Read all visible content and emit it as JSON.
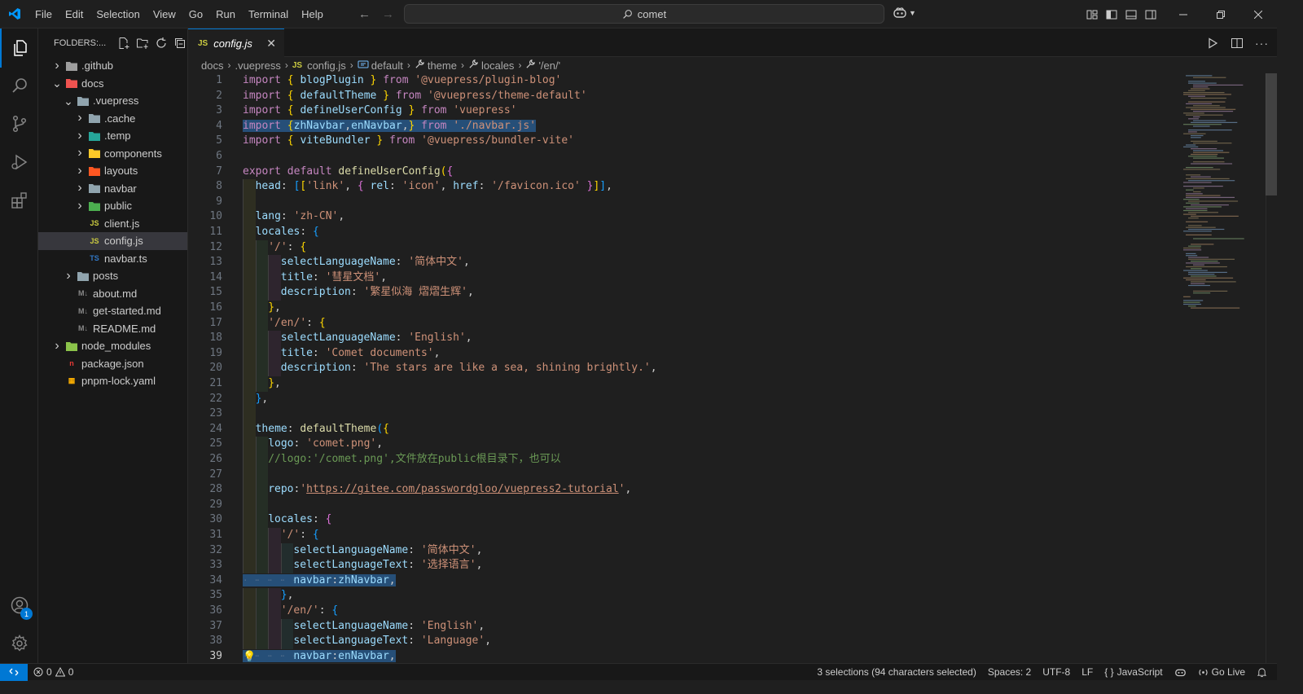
{
  "window": {
    "menu": [
      "File",
      "Edit",
      "Selection",
      "View",
      "Go",
      "Run",
      "Terminal",
      "Help"
    ],
    "search_text": "comet"
  },
  "sidebar": {
    "header_label": "FOLDERS:...",
    "tree": [
      {
        "label": ".github",
        "type": "folder",
        "expanded": false,
        "depth": 0,
        "icon": "github-folder-icon",
        "color": "#9e9e9e"
      },
      {
        "label": "docs",
        "type": "folder",
        "expanded": true,
        "depth": 0,
        "icon": "docs-folder-icon",
        "color": "#ef5350"
      },
      {
        "label": ".vuepress",
        "type": "folder",
        "expanded": true,
        "depth": 1,
        "icon": "folder-icon",
        "color": "#90a4ae"
      },
      {
        "label": ".cache",
        "type": "folder",
        "expanded": false,
        "depth": 2,
        "icon": "folder-icon",
        "color": "#90a4ae"
      },
      {
        "label": ".temp",
        "type": "folder",
        "expanded": false,
        "depth": 2,
        "icon": "temp-folder-icon",
        "color": "#26a69a"
      },
      {
        "label": "components",
        "type": "folder",
        "expanded": false,
        "depth": 2,
        "icon": "components-folder-icon",
        "color": "#ffca28"
      },
      {
        "label": "layouts",
        "type": "folder",
        "expanded": false,
        "depth": 2,
        "icon": "layouts-folder-icon",
        "color": "#ff5722"
      },
      {
        "label": "navbar",
        "type": "folder",
        "expanded": false,
        "depth": 2,
        "icon": "folder-icon",
        "color": "#90a4ae"
      },
      {
        "label": "public",
        "type": "folder",
        "expanded": false,
        "depth": 2,
        "icon": "public-folder-icon",
        "color": "#4caf50"
      },
      {
        "label": "client.js",
        "type": "file",
        "depth": 2,
        "icon": "js-file-icon",
        "color": "#cbcb41",
        "badge": "JS"
      },
      {
        "label": "config.js",
        "type": "file",
        "depth": 2,
        "icon": "js-file-icon",
        "color": "#cbcb41",
        "badge": "JS",
        "selected": true
      },
      {
        "label": "navbar.ts",
        "type": "file",
        "depth": 2,
        "icon": "ts-file-icon",
        "color": "#3178c6",
        "badge": "TS"
      },
      {
        "label": "posts",
        "type": "folder",
        "expanded": false,
        "depth": 1,
        "icon": "folder-icon",
        "color": "#90a4ae"
      },
      {
        "label": "about.md",
        "type": "file",
        "depth": 1,
        "icon": "md-file-icon",
        "color": "#888888",
        "badge": "M↓"
      },
      {
        "label": "get-started.md",
        "type": "file",
        "depth": 1,
        "icon": "md-file-icon",
        "color": "#888888",
        "badge": "M↓"
      },
      {
        "label": "README.md",
        "type": "file",
        "depth": 1,
        "icon": "md-file-icon",
        "color": "#888888",
        "badge": "M↓"
      },
      {
        "label": "node_modules",
        "type": "folder",
        "expanded": false,
        "depth": 0,
        "icon": "node-modules-folder-icon",
        "color": "#8bc34a"
      },
      {
        "label": "package.json",
        "type": "file",
        "depth": 0,
        "icon": "npm-file-icon",
        "color": "#e53935",
        "badge": "n"
      },
      {
        "label": "pnpm-lock.yaml",
        "type": "file",
        "depth": 0,
        "icon": "pnpm-file-icon",
        "color": "#f9ad00",
        "badge": "▦"
      }
    ]
  },
  "tabs": [
    {
      "label": "config.js",
      "badge": "JS",
      "active": true
    }
  ],
  "breadcrumbs": [
    {
      "label": "docs",
      "icon": ""
    },
    {
      "label": ".vuepress",
      "icon": ""
    },
    {
      "label": "config.js",
      "icon": "JS"
    },
    {
      "label": "default",
      "icon": "symbol-variable-icon"
    },
    {
      "label": "theme",
      "icon": "wrench-icon"
    },
    {
      "label": "locales",
      "icon": "wrench-icon"
    },
    {
      "label": "'/en/'",
      "icon": "wrench-icon"
    }
  ],
  "editor": {
    "lines": [
      {
        "n": 1,
        "indent": 0,
        "toks": [
          [
            "kw",
            "import "
          ],
          [
            "br1",
            "{ "
          ],
          [
            "var",
            "blogPlugin"
          ],
          [
            "br1",
            " }"
          ],
          [
            "kw",
            " from "
          ],
          [
            "str",
            "'@vuepress/plugin-blog'"
          ]
        ]
      },
      {
        "n": 2,
        "indent": 0,
        "toks": [
          [
            "kw",
            "import "
          ],
          [
            "br1",
            "{ "
          ],
          [
            "var",
            "defaultTheme"
          ],
          [
            "br1",
            " }"
          ],
          [
            "kw",
            " from "
          ],
          [
            "str",
            "'@vuepress/theme-default'"
          ]
        ]
      },
      {
        "n": 3,
        "indent": 0,
        "toks": [
          [
            "kw",
            "import "
          ],
          [
            "br1",
            "{ "
          ],
          [
            "var",
            "defineUserConfig"
          ],
          [
            "br1",
            " }"
          ],
          [
            "kw",
            " from "
          ],
          [
            "str",
            "'vuepress'"
          ]
        ]
      },
      {
        "n": 4,
        "indent": 0,
        "selected": true,
        "toks": [
          [
            "kw",
            "import "
          ],
          [
            "br1",
            "{"
          ],
          [
            "var",
            "zhNavbar"
          ],
          [
            "punc",
            ","
          ],
          [
            "var",
            "enNavbar"
          ],
          [
            "punc",
            ","
          ],
          [
            "br1",
            "}"
          ],
          [
            "kw",
            " from "
          ],
          [
            "str",
            "'./navbar.js'"
          ]
        ]
      },
      {
        "n": 5,
        "indent": 0,
        "toks": [
          [
            "kw",
            "import "
          ],
          [
            "br1",
            "{ "
          ],
          [
            "var",
            "viteBundler"
          ],
          [
            "br1",
            " }"
          ],
          [
            "kw",
            " from "
          ],
          [
            "str",
            "'@vuepress/bundler-vite'"
          ]
        ]
      },
      {
        "n": 6,
        "indent": 0,
        "toks": []
      },
      {
        "n": 7,
        "indent": 0,
        "toks": [
          [
            "kw",
            "export "
          ],
          [
            "kw",
            "default "
          ],
          [
            "fn",
            "defineUserConfig"
          ],
          [
            "br1",
            "("
          ],
          [
            "br2",
            "{"
          ]
        ]
      },
      {
        "n": 8,
        "indent": 1,
        "toks": [
          [
            "prop",
            "head"
          ],
          [
            "punc",
            ": "
          ],
          [
            "br3",
            "["
          ],
          [
            "br1",
            "["
          ],
          [
            "str",
            "'link'"
          ],
          [
            "punc",
            ", "
          ],
          [
            "br2",
            "{ "
          ],
          [
            "prop",
            "rel"
          ],
          [
            "punc",
            ": "
          ],
          [
            "str",
            "'icon'"
          ],
          [
            "punc",
            ", "
          ],
          [
            "prop",
            "href"
          ],
          [
            "punc",
            ": "
          ],
          [
            "str",
            "'/favicon.ico'"
          ],
          [
            "br2",
            " }"
          ],
          [
            "br1",
            "]"
          ],
          [
            "br3",
            "]"
          ],
          [
            "punc",
            ","
          ]
        ]
      },
      {
        "n": 9,
        "indent": 1,
        "toks": []
      },
      {
        "n": 10,
        "indent": 1,
        "toks": [
          [
            "prop",
            "lang"
          ],
          [
            "punc",
            ": "
          ],
          [
            "str",
            "'zh-CN'"
          ],
          [
            "punc",
            ","
          ]
        ]
      },
      {
        "n": 11,
        "indent": 1,
        "toks": [
          [
            "prop",
            "locales"
          ],
          [
            "punc",
            ": "
          ],
          [
            "br3",
            "{"
          ]
        ]
      },
      {
        "n": 12,
        "indent": 2,
        "toks": [
          [
            "str",
            "'/'"
          ],
          [
            "punc",
            ": "
          ],
          [
            "br1",
            "{"
          ]
        ]
      },
      {
        "n": 13,
        "indent": 3,
        "toks": [
          [
            "prop",
            "selectLanguageName"
          ],
          [
            "punc",
            ": "
          ],
          [
            "str",
            "'简体中文'"
          ],
          [
            "punc",
            ","
          ]
        ]
      },
      {
        "n": 14,
        "indent": 3,
        "toks": [
          [
            "prop",
            "title"
          ],
          [
            "punc",
            ": "
          ],
          [
            "str",
            "'彗星文档'"
          ],
          [
            "punc",
            ","
          ]
        ]
      },
      {
        "n": 15,
        "indent": 3,
        "toks": [
          [
            "prop",
            "description"
          ],
          [
            "punc",
            ": "
          ],
          [
            "str",
            "'繁星似海 熠熠生辉'"
          ],
          [
            "punc",
            ","
          ]
        ]
      },
      {
        "n": 16,
        "indent": 2,
        "toks": [
          [
            "br1",
            "}"
          ],
          [
            "punc",
            ","
          ]
        ]
      },
      {
        "n": 17,
        "indent": 2,
        "toks": [
          [
            "str",
            "'/en/'"
          ],
          [
            "punc",
            ": "
          ],
          [
            "br1",
            "{"
          ]
        ]
      },
      {
        "n": 18,
        "indent": 3,
        "toks": [
          [
            "prop",
            "selectLanguageName"
          ],
          [
            "punc",
            ": "
          ],
          [
            "str",
            "'English'"
          ],
          [
            "punc",
            ","
          ]
        ]
      },
      {
        "n": 19,
        "indent": 3,
        "toks": [
          [
            "prop",
            "title"
          ],
          [
            "punc",
            ": "
          ],
          [
            "str",
            "'Comet documents'"
          ],
          [
            "punc",
            ","
          ]
        ]
      },
      {
        "n": 20,
        "indent": 3,
        "toks": [
          [
            "prop",
            "description"
          ],
          [
            "punc",
            ": "
          ],
          [
            "str",
            "'The stars are like a sea, shining brightly.'"
          ],
          [
            "punc",
            ","
          ]
        ]
      },
      {
        "n": 21,
        "indent": 2,
        "toks": [
          [
            "br1",
            "}"
          ],
          [
            "punc",
            ","
          ]
        ]
      },
      {
        "n": 22,
        "indent": 1,
        "toks": [
          [
            "br3",
            "}"
          ],
          [
            "punc",
            ","
          ]
        ]
      },
      {
        "n": 23,
        "indent": 1,
        "toks": []
      },
      {
        "n": 24,
        "indent": 1,
        "toks": [
          [
            "prop",
            "theme"
          ],
          [
            "punc",
            ": "
          ],
          [
            "fn",
            "defaultTheme"
          ],
          [
            "br3",
            "("
          ],
          [
            "br1",
            "{"
          ]
        ]
      },
      {
        "n": 25,
        "indent": 2,
        "toks": [
          [
            "prop",
            "logo"
          ],
          [
            "punc",
            ": "
          ],
          [
            "str",
            "'comet.png'"
          ],
          [
            "punc",
            ","
          ]
        ]
      },
      {
        "n": 26,
        "indent": 2,
        "toks": [
          [
            "cm",
            "//logo:'/comet.png',文件放在public根目录下，也可以"
          ]
        ]
      },
      {
        "n": 27,
        "indent": 2,
        "toks": []
      },
      {
        "n": 28,
        "indent": 2,
        "toks": [
          [
            "prop",
            "repo"
          ],
          [
            "punc",
            ":"
          ],
          [
            "str",
            "'"
          ],
          [
            "url",
            "https://gitee.com/passwordgloo/vuepress2-tutorial"
          ],
          [
            "str",
            "'"
          ],
          [
            "punc",
            ","
          ]
        ]
      },
      {
        "n": 29,
        "indent": 2,
        "toks": []
      },
      {
        "n": 30,
        "indent": 2,
        "toks": [
          [
            "prop",
            "locales"
          ],
          [
            "punc",
            ": "
          ],
          [
            "br2",
            "{"
          ]
        ]
      },
      {
        "n": 31,
        "indent": 3,
        "toks": [
          [
            "str",
            "'/'"
          ],
          [
            "punc",
            ": "
          ],
          [
            "br3",
            "{"
          ]
        ]
      },
      {
        "n": 32,
        "indent": 4,
        "toks": [
          [
            "prop",
            "selectLanguageName"
          ],
          [
            "punc",
            ": "
          ],
          [
            "str",
            "'简体中文'"
          ],
          [
            "punc",
            ","
          ]
        ]
      },
      {
        "n": 33,
        "indent": 4,
        "toks": [
          [
            "prop",
            "selectLanguageText"
          ],
          [
            "punc",
            ": "
          ],
          [
            "str",
            "'选择语言'"
          ],
          [
            "punc",
            ","
          ]
        ]
      },
      {
        "n": 34,
        "indent": 4,
        "selected": true,
        "dots": true,
        "toks": [
          [
            "prop",
            "navbar"
          ],
          [
            "punc",
            ":"
          ],
          [
            "var",
            "zhNavbar"
          ],
          [
            "punc",
            ","
          ]
        ]
      },
      {
        "n": 35,
        "indent": 3,
        "toks": [
          [
            "br3",
            "}"
          ],
          [
            "punc",
            ","
          ]
        ]
      },
      {
        "n": 36,
        "indent": 3,
        "toks": [
          [
            "str",
            "'/en/'"
          ],
          [
            "punc",
            ": "
          ],
          [
            "br3",
            "{"
          ]
        ]
      },
      {
        "n": 37,
        "indent": 4,
        "toks": [
          [
            "prop",
            "selectLanguageName"
          ],
          [
            "punc",
            ": "
          ],
          [
            "str",
            "'English'"
          ],
          [
            "punc",
            ","
          ]
        ]
      },
      {
        "n": 38,
        "indent": 4,
        "toks": [
          [
            "prop",
            "selectLanguageText"
          ],
          [
            "punc",
            ": "
          ],
          [
            "str",
            "'Language'"
          ],
          [
            "punc",
            ","
          ]
        ]
      },
      {
        "n": 39,
        "indent": 4,
        "selected": true,
        "dots": true,
        "current": true,
        "toks": [
          [
            "prop",
            "navbar"
          ],
          [
            "punc",
            ":"
          ],
          [
            "var",
            "enNavbar"
          ],
          [
            "punc",
            ","
          ]
        ]
      }
    ]
  },
  "statusbar": {
    "errors": "0",
    "warnings": "0",
    "selection": "3 selections (94 characters selected)",
    "spaces": "Spaces: 2",
    "encoding": "UTF-8",
    "eol": "LF",
    "language": "JavaScript",
    "golive": "Go Live"
  },
  "activity": {
    "accounts_badge": "1"
  },
  "colors": {
    "accent": "#0078d4",
    "selection": "#264f78"
  }
}
